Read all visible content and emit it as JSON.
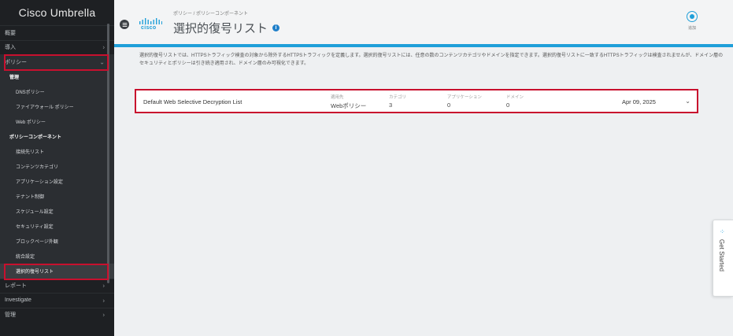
{
  "sidebar": {
    "brand": "Cisco Umbrella",
    "items": [
      {
        "label": "概要",
        "chevron": ""
      },
      {
        "label": "導入",
        "chevron": "›"
      },
      {
        "label": "ポリシー",
        "chevron": "⌄"
      }
    ],
    "submenu": {
      "management_header": "管理",
      "management_items": [
        "DNSポリシー",
        "ファイアウォール ポリシー",
        "Web ポリシー"
      ],
      "components_header": "ポリシーコンポーネント",
      "component_items": [
        "接続先リスト",
        "コンテンツカテゴリ",
        "アプリケーション設定",
        "テナント制御",
        "スケジュール設定",
        "セキュリティ設定",
        "ブロックページ外観",
        "統合設定",
        "選択的復号リスト"
      ]
    },
    "bottom_items": [
      {
        "label": "レポート",
        "chevron": "›"
      },
      {
        "label": "Investigate",
        "chevron": "›"
      },
      {
        "label": "管理",
        "chevron": "›"
      }
    ]
  },
  "header": {
    "breadcrumb": "ポリシー / ポリシーコンポーネント",
    "title": "選択的復号リスト",
    "info_icon": "i",
    "logo_text": "cisco",
    "add_label": "追加"
  },
  "description": "選択的復号リストでは、HTTPSトラフィック検査の対象から除外するHTTPSトラフィックを定義します。選択的復号リストには、任意の数のコンテンツカテゴリやドメインを指定できます。選択的復号リストに一致するHTTPSトラフィックは検査されませんが、ドメイン層のセキュリティとポリシーは引き続き適用され、ドメイン層のみ可視化できます。",
  "list": [
    {
      "name": "Default Web Selective Decryption List",
      "applied_label": "適用先",
      "applied_value": "Webポリシー",
      "category_label": "カテゴリ",
      "category_value": "3",
      "app_label": "アプリケーション",
      "app_value": "0",
      "domain_label": "ドメイン",
      "domain_value": "0",
      "date": "Apr 09, 2025",
      "expand_icon": "⌄"
    }
  ],
  "get_started": {
    "label": "Get Started",
    "icon": "⁘"
  },
  "colors": {
    "accent": "#1f9fd9",
    "highlight": "#c8102e",
    "sidebar_bg": "#1e2023"
  }
}
